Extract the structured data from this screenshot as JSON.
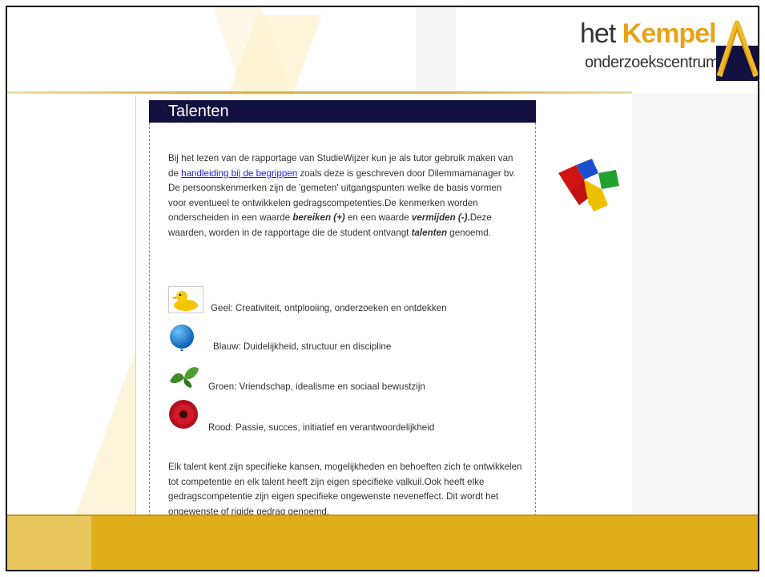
{
  "logo": {
    "het": "het",
    "kempel": "Kempel",
    "sub": "onderzoekscentrum"
  },
  "section": {
    "title": "Talenten"
  },
  "intro": {
    "p1_before_link": "Bij het lezen van de rapportage van StudieWijzer kun je als tutor gebruik maken van de ",
    "link_text": "handleiding bij de begrippen",
    "p1_after_link": " zoals deze is geschreven door Dilemmamanager bv.",
    "p2_part1": "De persoonskenmerken zijn de 'gemeten' uitgangspunten welke de basis vormen voor eventueel te ontwikkelen gedragscompetenties.De kenmerken worden onderscheiden in een waarde ",
    "bereiken": "bereiken (+)",
    "p2_part2": " en een waarde ",
    "vermijden": "vermijden (-).",
    "p2_part3": "Deze waarden, worden in de rapportage die de student ontvangt ",
    "talenten": "talenten",
    "p2_part4": " genoemd."
  },
  "talents": [
    {
      "icon": "duck-icon",
      "label": "Geel: Creativiteit, ontplooiing, onderzoeken en ontdekken"
    },
    {
      "icon": "balloon-icon",
      "label": "Blauw: Duidelijkheid, structuur en discipline"
    },
    {
      "icon": "leaves-icon",
      "label": "Groen: Vriendschap, idealisme en sociaal bewustzijn"
    },
    {
      "icon": "flower-icon",
      "label": "Rood: Passie, succes, initiatief en verantwoordelijkheid"
    }
  ],
  "outro": "Elk talent kent zijn specifieke kansen, mogelijkheden en behoeften zich te ontwikkelen tot competentie en elk talent heeft zijn eigen specifieke valkuil.Ook heeft elke gedragscompetentie zijn eigen specifieke ongewenste neveneffect. Dit wordt het ongewenste of rigide gedrag genoemd.",
  "colors": {
    "title_bar": "#12103f",
    "accent": "#e8a318",
    "footer": "#dfae1a",
    "link": "#1a1aee"
  }
}
